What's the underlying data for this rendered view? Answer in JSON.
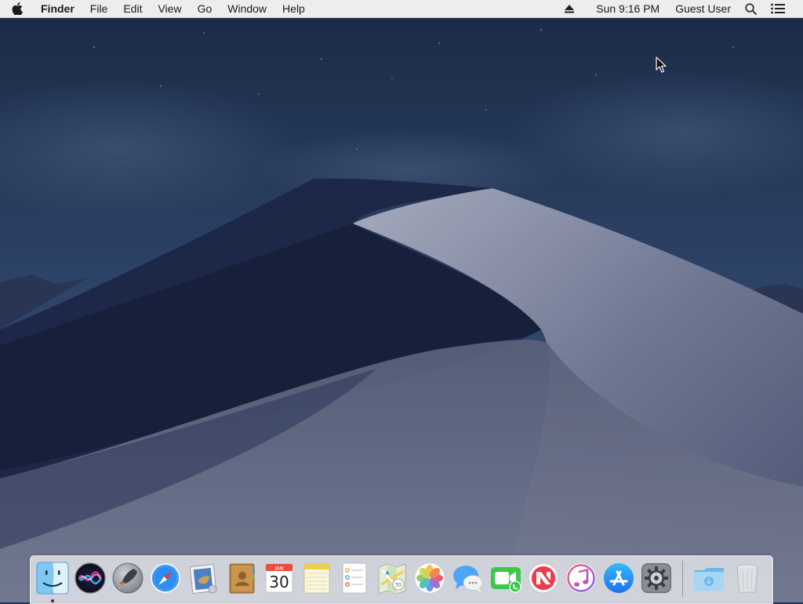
{
  "menubar": {
    "app_name": "Finder",
    "menus": [
      "File",
      "Edit",
      "View",
      "Go",
      "Window",
      "Help"
    ],
    "clock": "Sun 9:16 PM",
    "user": "Guest User"
  },
  "dock": {
    "apps": [
      {
        "name": "Finder",
        "running": true
      },
      {
        "name": "Siri"
      },
      {
        "name": "Launchpad"
      },
      {
        "name": "Safari"
      },
      {
        "name": "Mail"
      },
      {
        "name": "Contacts"
      },
      {
        "name": "Calendar",
        "month": "JAN",
        "day": "30"
      },
      {
        "name": "Notes"
      },
      {
        "name": "Reminders"
      },
      {
        "name": "Maps"
      },
      {
        "name": "Photos"
      },
      {
        "name": "Messages"
      },
      {
        "name": "FaceTime"
      },
      {
        "name": "News"
      },
      {
        "name": "iTunes"
      },
      {
        "name": "App Store"
      },
      {
        "name": "System Preferences"
      }
    ],
    "right": [
      {
        "name": "Downloads"
      },
      {
        "name": "Trash"
      }
    ]
  },
  "colors": {
    "sky_top": "#1c2b47",
    "sky_bottom": "#31486c",
    "dune_dark": "#1d2846",
    "dune_light": "#8b92a8"
  }
}
